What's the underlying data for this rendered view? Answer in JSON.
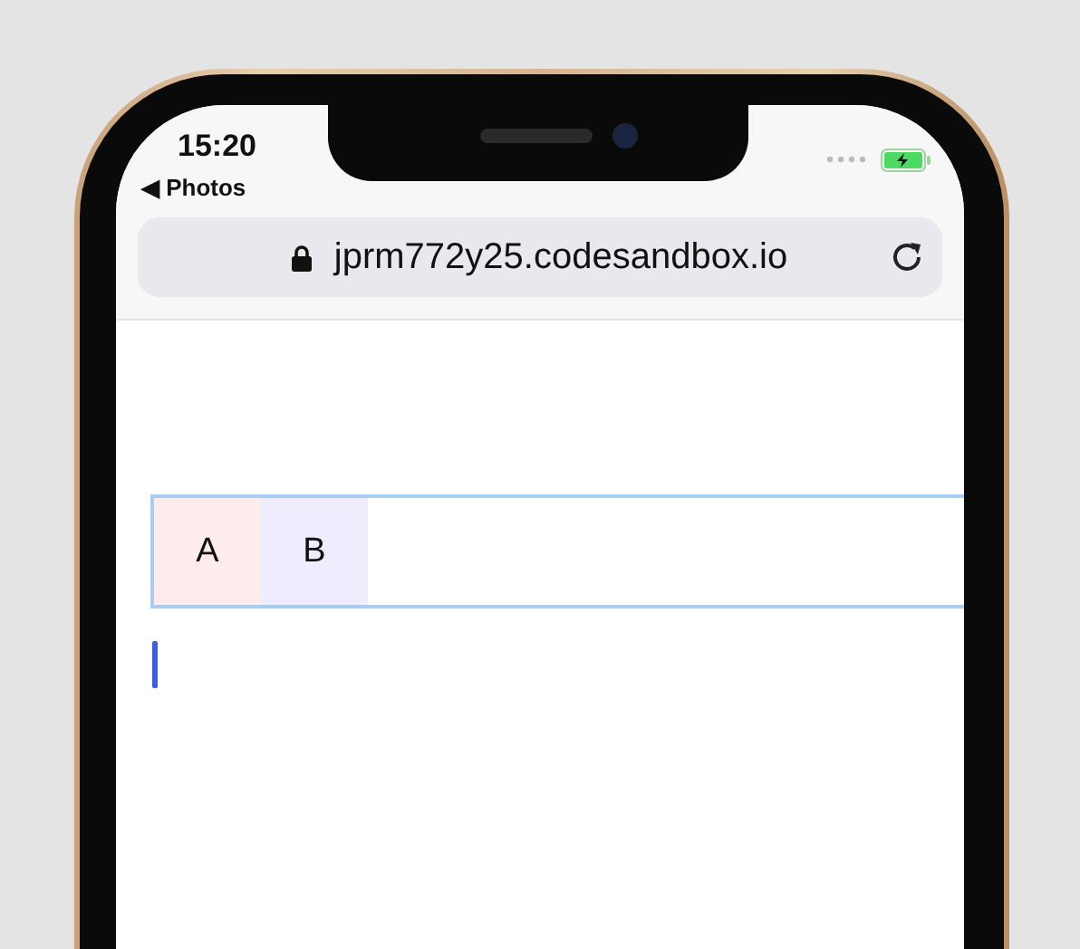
{
  "status_bar": {
    "time": "15:20",
    "back_label": "◀ Photos"
  },
  "address_bar": {
    "url": "jprm772y25.codesandbox.io"
  },
  "tabs": [
    {
      "label": "A",
      "color": "#fdeceb"
    },
    {
      "label": "B",
      "color": "#efedfd"
    }
  ]
}
